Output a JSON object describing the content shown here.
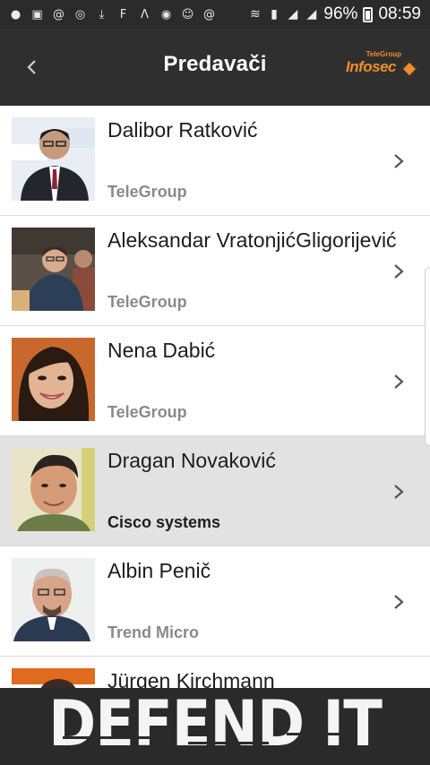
{
  "status_bar": {
    "battery": "96%",
    "time": "08:59",
    "left_icons": [
      "chat-icon",
      "image-icon",
      "at-icon",
      "search-icon",
      "download-icon",
      "f-icon",
      "a-icon",
      "volume-icon",
      "face-icon",
      "at-icon"
    ],
    "right_icons": [
      "wifi-icon",
      "sim-icon",
      "signal-icon",
      "signal-icon",
      "battery-icon"
    ]
  },
  "header": {
    "title": "Predavači",
    "back_icon": "back-arrow-icon",
    "logo_small": "TeleGroup",
    "logo_main": "Infosec"
  },
  "speakers": [
    {
      "name": "Dalibor Ratković",
      "company": "TeleGroup",
      "selected": false
    },
    {
      "name": "Aleksandar VratonjićGligorijević",
      "company": "TeleGroup",
      "selected": false
    },
    {
      "name": "Nena Dabić",
      "company": "TeleGroup",
      "selected": false
    },
    {
      "name": "Dragan Novaković",
      "company": "Cisco systems",
      "selected": true
    },
    {
      "name": "Albin Penič",
      "company": "Trend Micro",
      "selected": false
    },
    {
      "name": "Jürgen Kirchmann",
      "company": "",
      "selected": false
    }
  ],
  "banner": {
    "text": "DEFEND IT"
  },
  "colors": {
    "app_bar": "#2f2f2f",
    "accent": "#f08c2a",
    "selected_row": "#e2e2e2",
    "company_text": "#8a8a8a"
  }
}
